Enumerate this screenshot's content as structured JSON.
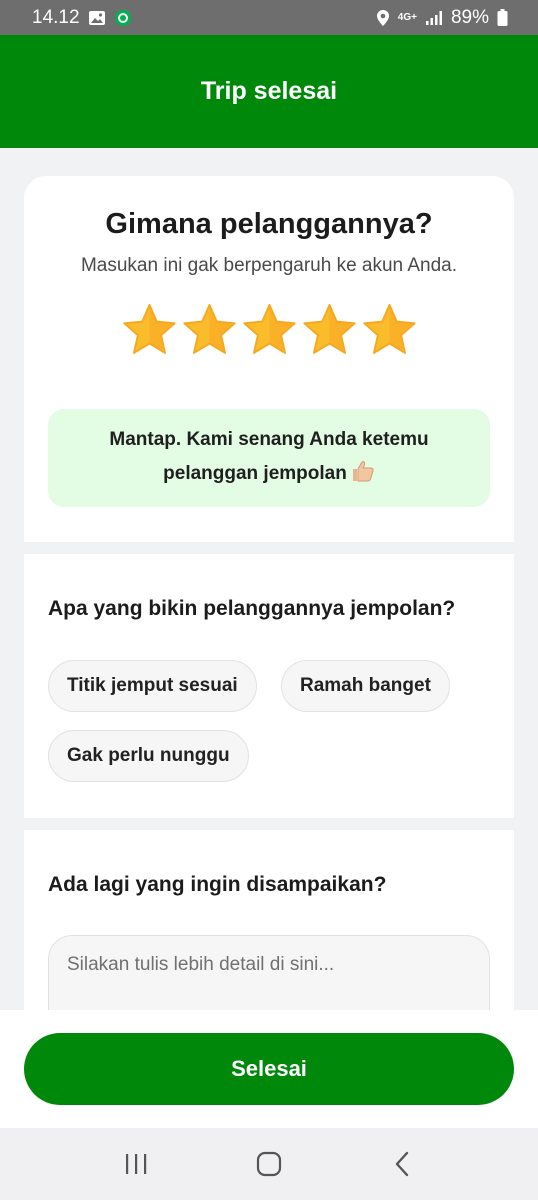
{
  "status_bar": {
    "time": "14.12",
    "network": "4G+",
    "battery": "89%"
  },
  "header": {
    "title": "Trip selesai"
  },
  "rating": {
    "title": "Gimana pelanggannya?",
    "subtitle": "Masukan ini gak berpengaruh ke akun Anda.",
    "stars_filled": 5,
    "stars_total": 5,
    "banner_text": "Mantap. Kami senang Anda ketemu pelanggan jempolan"
  },
  "reasons": {
    "title": "Apa yang bikin pelanggannya jempolan?",
    "chips": [
      "Titik jemput sesuai",
      "Ramah banget",
      "Gak perlu nunggu"
    ]
  },
  "comment": {
    "title": "Ada lagi yang ingin disampaikan?",
    "placeholder": "Silakan tulis lebih detail di sini..."
  },
  "footer": {
    "done_label": "Selesai"
  },
  "colors": {
    "brand_green": "#00880b",
    "banner_bg": "#e3fce4",
    "star": "#fbbc2c"
  }
}
